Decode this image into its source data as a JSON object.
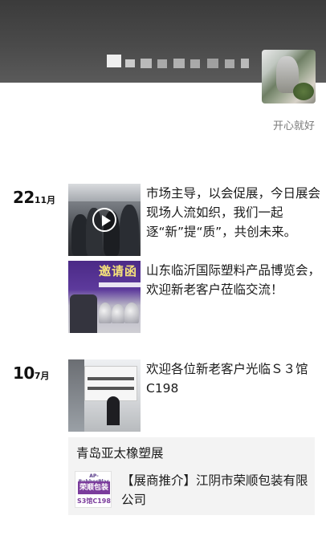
{
  "profile": {
    "signature": "开心就好",
    "avatar_icon": "avatar-photo"
  },
  "days": [
    {
      "day": "22",
      "month": "11月",
      "posts": [
        {
          "text": "市场主导，以会促展，今日展会现场人流如织，我们一起逐“新”提“质”，共创未来。",
          "has_video": true
        },
        {
          "text": "山东临沂国际塑料产品博览会，欢迎新老客户莅临交流！",
          "thumb_banner": "邀请函"
        }
      ]
    },
    {
      "day": "10",
      "month": "7月",
      "posts": [
        {
          "text": "欢迎各位新老客户光临Ｓ３馆C198"
        }
      ],
      "share": {
        "title": "青岛亚太橡塑展",
        "text": "【展商推介】江阴市荣顺包装有限公司",
        "thumb_top": "AP-RubberPlas",
        "thumb_main": "荣顺包装",
        "thumb_bottom": "S3馆C198"
      }
    }
  ]
}
